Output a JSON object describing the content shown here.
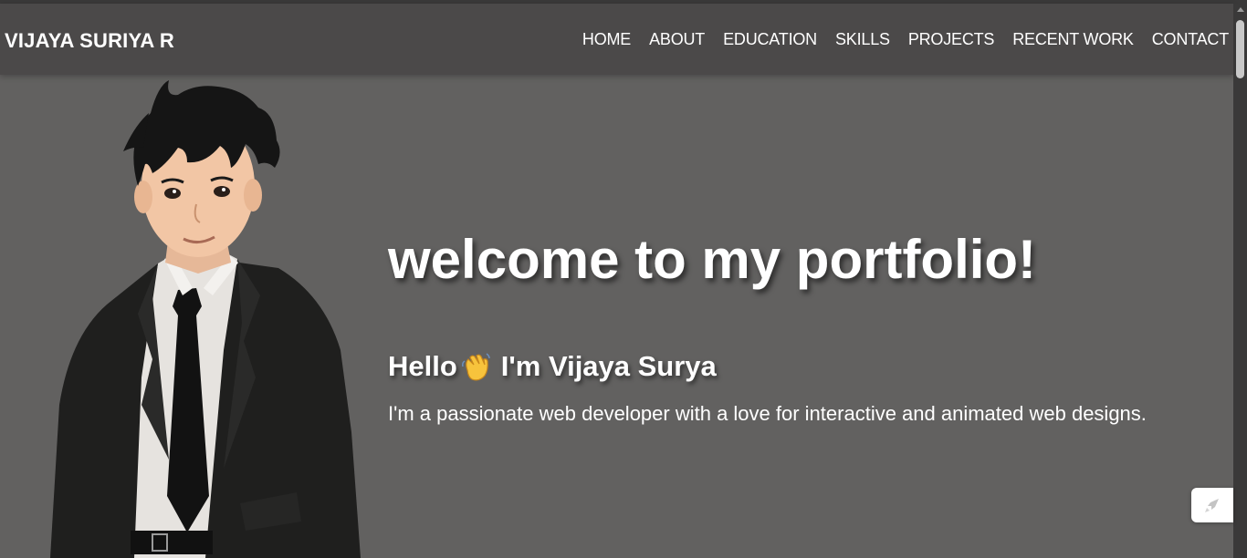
{
  "brand": {
    "name": "VIJAYA SURIYA R"
  },
  "nav": {
    "items": [
      {
        "label": "HOME"
      },
      {
        "label": "ABOUT"
      },
      {
        "label": "EDUCATION"
      },
      {
        "label": "SKILLS"
      },
      {
        "label": "PROJECTS"
      },
      {
        "label": "RECENT WORK"
      },
      {
        "label": "CONTACT"
      }
    ]
  },
  "hero": {
    "title": "welcome to my portfolio!",
    "greeting_hello": "Hello",
    "greeting_rest": "I'm Vijaya Surya",
    "wave_icon": "waving-hand-icon",
    "description": "I'm a passionate web developer with a love for interactive and animated web designs.",
    "avatar_icon": "avatar-illustration"
  },
  "floating_button": {
    "icon": "rocket-icon"
  },
  "colors": {
    "background": "#626160",
    "navbar": "#4b4949",
    "text": "#ffffff",
    "scrollbar_track": "#3a3939",
    "scrollbar_thumb": "#c9c9c9"
  }
}
